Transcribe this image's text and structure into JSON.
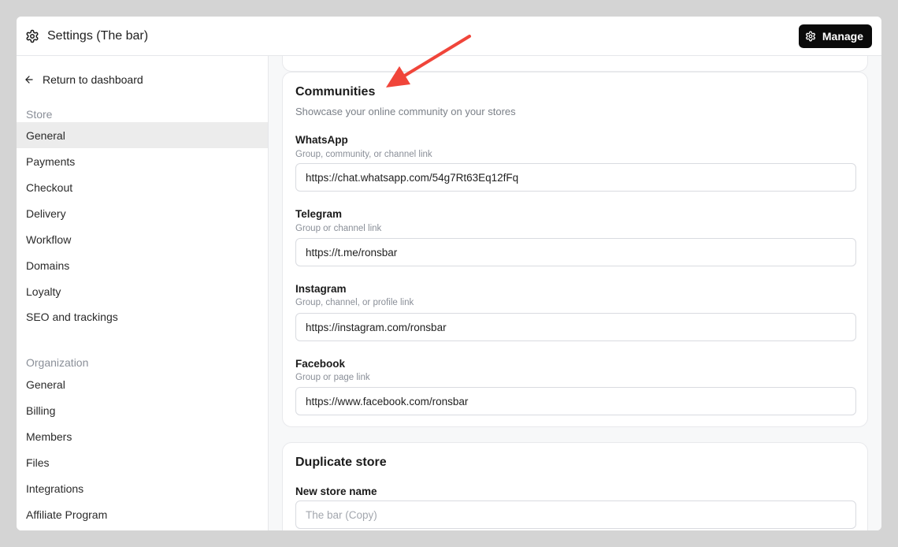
{
  "header": {
    "title": "Settings (The bar)",
    "manage_label": "Manage"
  },
  "sidebar": {
    "back_label": "Return to dashboard",
    "store_label": "Store",
    "store_items": [
      "General",
      "Payments",
      "Checkout",
      "Delivery",
      "Workflow",
      "Domains",
      "Loyalty",
      "SEO and trackings"
    ],
    "active_item": "General",
    "organization_label": "Organization",
    "organization_items": [
      "General",
      "Billing",
      "Members",
      "Files",
      "Integrations",
      "Affiliate Program"
    ]
  },
  "communities": {
    "title": "Communities",
    "subtitle": "Showcase your online community on your stores",
    "fields": [
      {
        "label": "WhatsApp",
        "hint": "Group, community, or channel link",
        "value": "https://chat.whatsapp.com/54g7Rt63Eq12fFq"
      },
      {
        "label": "Telegram",
        "hint": "Group or channel link",
        "value": "https://t.me/ronsbar"
      },
      {
        "label": "Instagram",
        "hint": "Group, channel, or profile link",
        "value": "https://instagram.com/ronsbar"
      },
      {
        "label": "Facebook",
        "hint": "Group or page link",
        "value": "https://www.facebook.com/ronsbar"
      }
    ]
  },
  "duplicate_store": {
    "title": "Duplicate store",
    "name_label": "New store name",
    "name_placeholder": "The bar (Copy)",
    "name_value": ""
  },
  "colors": {
    "annotation_arrow": "#f0453a",
    "primary_button": "#0a0a0a",
    "active_nav_bg": "#ececec"
  }
}
